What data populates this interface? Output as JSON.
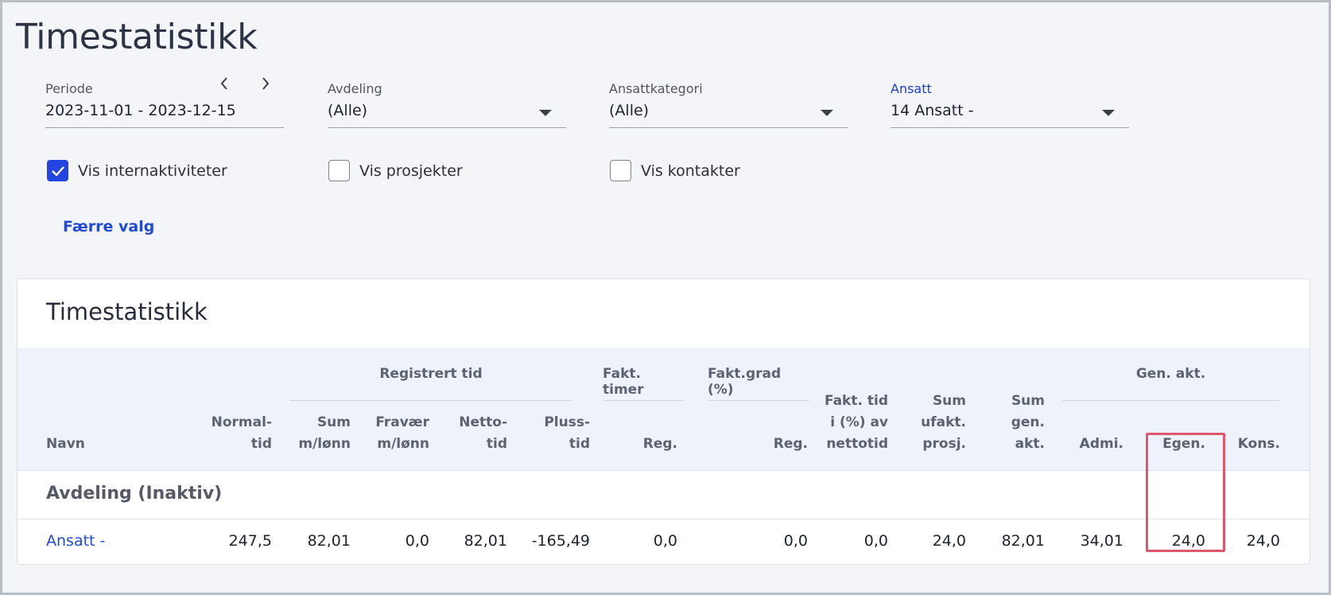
{
  "page": {
    "title": "Timestatistikk"
  },
  "filters": {
    "periode": {
      "label": "Periode",
      "value": "2023-11-01 - 2023-12-15",
      "prev_icon": "chevron-left-icon",
      "next_icon": "chevron-right-icon"
    },
    "avdeling": {
      "label": "Avdeling",
      "value": "(Alle)"
    },
    "ansattkategori": {
      "label": "Ansattkategori",
      "value": "(Alle)"
    },
    "ansatt": {
      "label": "Ansatt",
      "value": "14 Ansatt -"
    }
  },
  "options": {
    "internaktiviteter": {
      "label": "Vis internaktiviteter",
      "checked": true
    },
    "prosjekter": {
      "label": "Vis prosjekter",
      "checked": false
    },
    "kontakter": {
      "label": "Vis kontakter",
      "checked": false
    }
  },
  "fewer_options_link": "Færre valg",
  "panel": {
    "title": "Timestatistikk",
    "groups": {
      "registrert": "Registrert tid",
      "fakt_timer": "Fakt. timer",
      "fakt_grad": "Fakt.grad (%)",
      "gen_akt": "Gen. akt."
    },
    "columns": {
      "navn": "Navn",
      "normal": [
        "Normal-",
        "tid"
      ],
      "sum_lonn": [
        "Sum",
        "m/lønn"
      ],
      "fravaer": [
        "Fravær",
        "m/lønn"
      ],
      "netto": [
        "Netto-",
        "tid"
      ],
      "pluss": [
        "Pluss-",
        "tid"
      ],
      "fakt_reg": "Reg.",
      "grad_reg": "Reg.",
      "fakt_tid_pct": [
        "Fakt. tid",
        "i (%) av",
        "nettotid"
      ],
      "sum_ufakt": [
        "Sum",
        "ufakt.",
        "prosj."
      ],
      "sum_gen": [
        "Sum",
        "gen.",
        "akt."
      ],
      "admi": "Admi.",
      "egen": "Egen.",
      "kons": "Kons."
    },
    "section_label": "Avdeling (Inaktiv)",
    "row": {
      "name": "Ansatt -",
      "normal": "247,5",
      "sum_lonn": "82,01",
      "fravaer": "0,0",
      "netto": "82,01",
      "pluss": "-165,49",
      "fakt_reg": "0,0",
      "grad_reg": "0,0",
      "fakt_tid_pct": "0,0",
      "sum_ufakt": "24,0",
      "sum_gen": "82,01",
      "admi": "34,01",
      "egen": "24,0",
      "kons": "24,0"
    }
  },
  "colors": {
    "accent": "#1f4bd6",
    "highlight": "#e0566b",
    "header_bg": "#eef2fb"
  }
}
